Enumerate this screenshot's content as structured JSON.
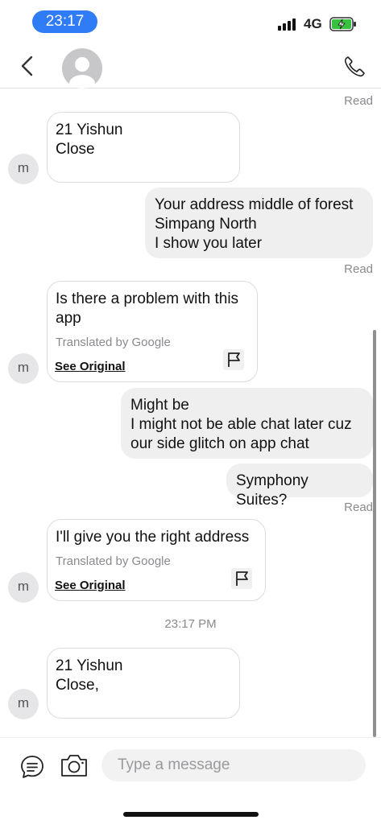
{
  "status_bar": {
    "time": "23:17",
    "network": "4G"
  },
  "header": {
    "contact_name": ""
  },
  "messages": {
    "read_1": "Read",
    "in_1": {
      "avatar_letter": "m",
      "line1": "21 Yishun",
      "line2": "Close"
    },
    "out_1": {
      "line1": "Your address middle of forest",
      "line2": "Simpang North",
      "line3": "I show you later"
    },
    "read_2": "Read",
    "in_2": {
      "avatar_letter": "m",
      "line1": "Is there a problem with this",
      "line2": "app",
      "translated": "Translated by Google",
      "see_original": "See Original"
    },
    "out_2": {
      "line1": "Might be",
      "line2": "I might not be able chat later cuz",
      "line3": "our side glitch on app chat"
    },
    "out_3": {
      "text": "Symphony Suites?"
    },
    "read_3": "Read",
    "in_3": {
      "avatar_letter": "m",
      "text": "I'll give you the right address",
      "translated": "Translated by Google",
      "see_original": "See Original"
    },
    "timestamp": "23:17 PM",
    "in_4": {
      "avatar_letter": "m",
      "line1": "21 Yishun",
      "line2": "Close,"
    }
  },
  "composer": {
    "placeholder": "Type a message"
  },
  "colors": {
    "accent": "#2f7cf6",
    "battery_charge": "#36c13f"
  },
  "icons": [
    "back-icon",
    "phone-icon",
    "flag-icon",
    "chat-icon",
    "camera-icon",
    "battery-charging-icon",
    "signal-icon"
  ]
}
